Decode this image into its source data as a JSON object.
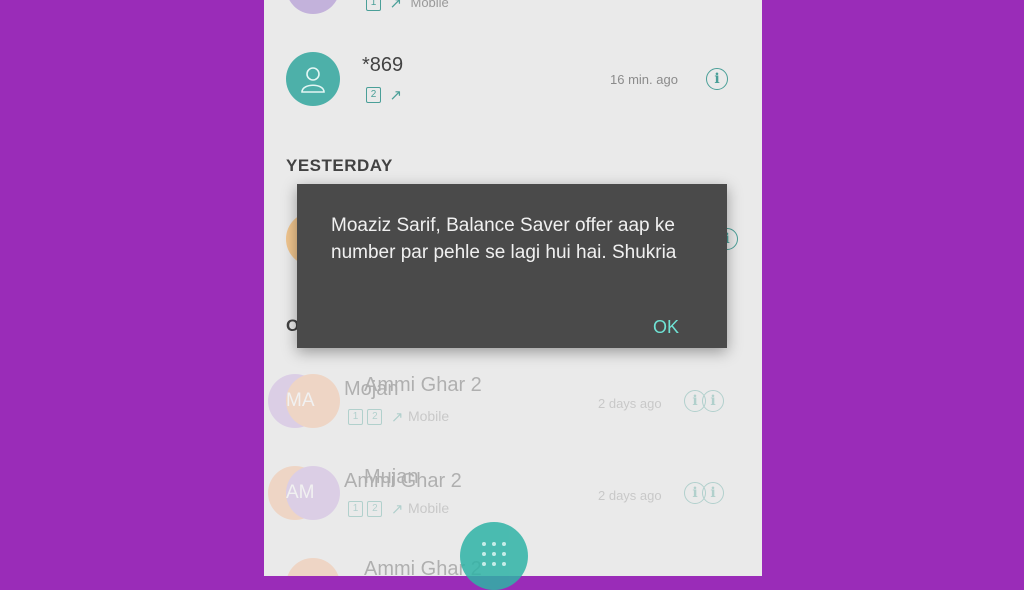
{
  "call_log": {
    "top_partial": {
      "sim": "1",
      "type": "Mobile"
    },
    "recent_entry": {
      "number": "*869",
      "sim": "2",
      "time": "16 min. ago"
    },
    "section_yesterday": "YESTERDAY",
    "section_older": "O",
    "ghost_entries": [
      {
        "name": "Mojan",
        "alt_name": "Ammi Ghar 2",
        "initials": "MA",
        "sim": "1",
        "sim2": "2",
        "type": "Mobile",
        "time": "2 days ago"
      },
      {
        "name": "Ammi Ghar 2",
        "alt_name": "Mujan",
        "initials": "AM",
        "sim": "1",
        "sim2": "2",
        "type": "Mobile",
        "time": "2 days ago"
      },
      {
        "name": "Ammi Ghar 2",
        "alt_name": "",
        "initials": "",
        "sim": "",
        "sim2": "",
        "type": "",
        "time": ""
      }
    ]
  },
  "dialog": {
    "message": "Moaziz Sarif, Balance Saver offer aap ke number par pehle se lagi hui hai. Shukria",
    "ok_label": "OK"
  },
  "colors": {
    "accent": "#2b8f86",
    "background": "#9a2cb8",
    "dialog_bg": "#4a4a4a",
    "ok_text": "#6fe2d4"
  },
  "icons": [
    "contact-avatar-icon",
    "info-icon",
    "outgoing-call-icon",
    "sim-icon",
    "dialpad-icon"
  ]
}
